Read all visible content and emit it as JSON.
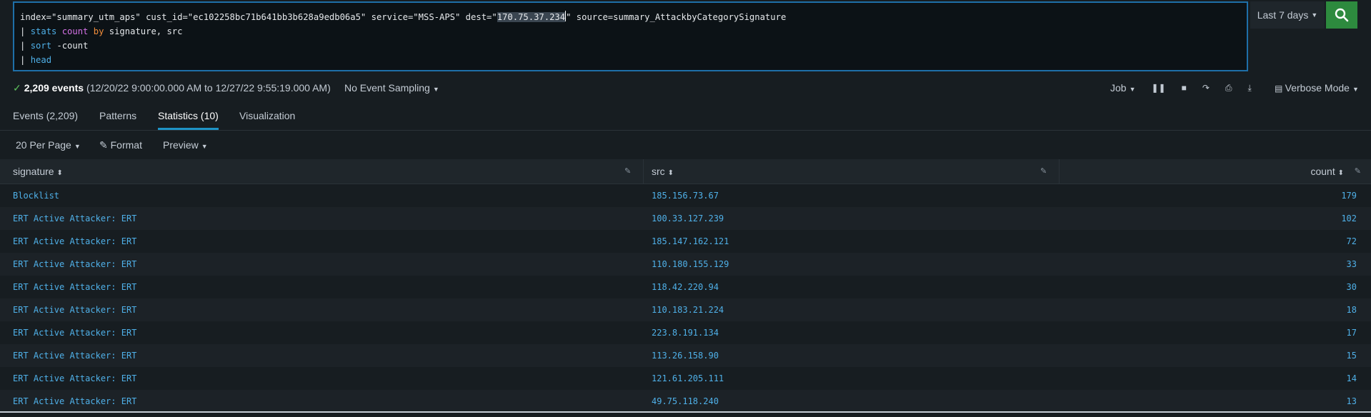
{
  "search": {
    "line1_a": "index=\"summary_utm_aps\" cust_id=\"ec102258bc71b641bb3b628a9edb06a5\" service=\"MSS-APS\" dest=\"",
    "line1_hl": "170.75.37.234",
    "line1_b": "\" source=summary_AttackbyCategorySignature",
    "line2_pipe": "| ",
    "line2_stats": "stats",
    "line2_count": " count",
    "line2_by": " by",
    "line2_rest": " signature, src",
    "line3_pipe": "| ",
    "line3_sort": "sort",
    "line3_rest": " -count",
    "line4_pipe": "| ",
    "line4_head": "head"
  },
  "time_range": {
    "label": "Last 7 days"
  },
  "meta": {
    "events": "2,209 events",
    "range": "(12/20/22 9:00:00.000 AM to 12/27/22 9:55:19.000 AM)",
    "sampling": "No Event Sampling",
    "job": "Job",
    "mode": "Verbose Mode"
  },
  "tabs": [
    {
      "label": "Events (2,209)"
    },
    {
      "label": "Patterns"
    },
    {
      "label": "Statistics (10)"
    },
    {
      "label": "Visualization"
    }
  ],
  "toolbar": {
    "per_page": "20 Per Page",
    "format": "Format",
    "preview": "Preview"
  },
  "table": {
    "headers": {
      "signature": "signature",
      "src": "src",
      "count": "count"
    },
    "rows": [
      {
        "signature": "Blocklist",
        "src": "185.156.73.67",
        "count": "179"
      },
      {
        "signature": "ERT Active Attacker: ERT",
        "src": "100.33.127.239",
        "count": "102"
      },
      {
        "signature": "ERT Active Attacker: ERT",
        "src": "185.147.162.121",
        "count": "72"
      },
      {
        "signature": "ERT Active Attacker: ERT",
        "src": "110.180.155.129",
        "count": "33"
      },
      {
        "signature": "ERT Active Attacker: ERT",
        "src": "118.42.220.94",
        "count": "30"
      },
      {
        "signature": "ERT Active Attacker: ERT",
        "src": "110.183.21.224",
        "count": "18"
      },
      {
        "signature": "ERT Active Attacker: ERT",
        "src": "223.8.191.134",
        "count": "17"
      },
      {
        "signature": "ERT Active Attacker: ERT",
        "src": "113.26.158.90",
        "count": "15"
      },
      {
        "signature": "ERT Active Attacker: ERT",
        "src": "121.61.205.111",
        "count": "14"
      },
      {
        "signature": "ERT Active Attacker: ERT",
        "src": "49.75.118.240",
        "count": "13"
      }
    ]
  }
}
